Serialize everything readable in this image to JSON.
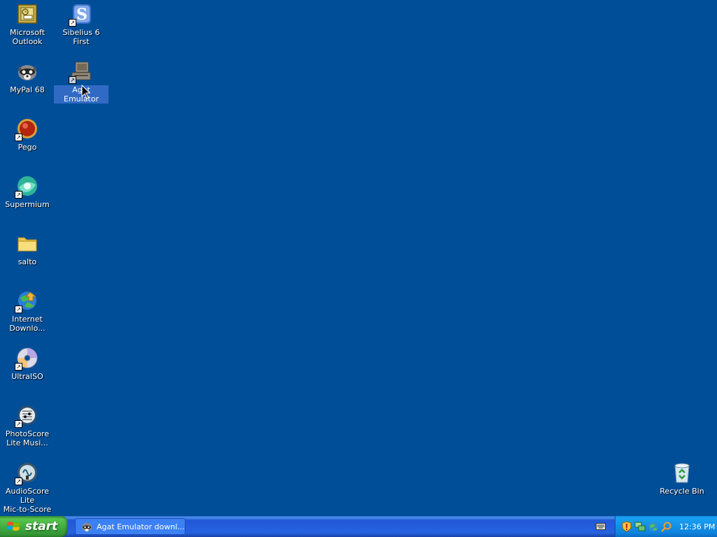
{
  "desktop": {
    "icons": [
      {
        "label": "Microsoft\nOutlook",
        "icon": "outlook-icon",
        "shortcut": false
      },
      {
        "label": "Sibelius 6 First",
        "icon": "sibelius-icon",
        "shortcut": true
      },
      {
        "label": "MyPal 68",
        "icon": "mypal-icon",
        "shortcut": false
      },
      {
        "label": "Agat Emulator",
        "icon": "agat-emulator-icon",
        "shortcut": true,
        "selected": true
      },
      {
        "label": "Pego",
        "icon": "pego-icon",
        "shortcut": true
      },
      {
        "label": "Supermium",
        "icon": "supermium-icon",
        "shortcut": true
      },
      {
        "label": "salto",
        "icon": "folder-icon",
        "shortcut": false
      },
      {
        "label": "Internet\nDownlo...",
        "icon": "internet-download-icon",
        "shortcut": true
      },
      {
        "label": "UltraISO",
        "icon": "ultraiso-icon",
        "shortcut": true
      },
      {
        "label": "PhotoScore\nLite Musi...",
        "icon": "photoscore-icon",
        "shortcut": true
      },
      {
        "label": "AudioScore Lite\nMic-to-Score",
        "icon": "audioscore-icon",
        "shortcut": true
      },
      {
        "label": "Recycle Bin",
        "icon": "recycle-bin-icon",
        "shortcut": false
      }
    ]
  },
  "taskbar": {
    "start_label": "start",
    "tasks": [
      {
        "label": "Agat Emulator downl...",
        "icon": "raccoon-icon"
      }
    ],
    "tray_icons": [
      "security-shield-icon",
      "network-icon",
      "globe-icon",
      "search-icon"
    ],
    "clock": "12:36 PM"
  },
  "colors": {
    "desktop_background": "#004e98",
    "taskbar": "#2663e0",
    "start_button": "#3da83d",
    "selection": "#316ac5"
  }
}
